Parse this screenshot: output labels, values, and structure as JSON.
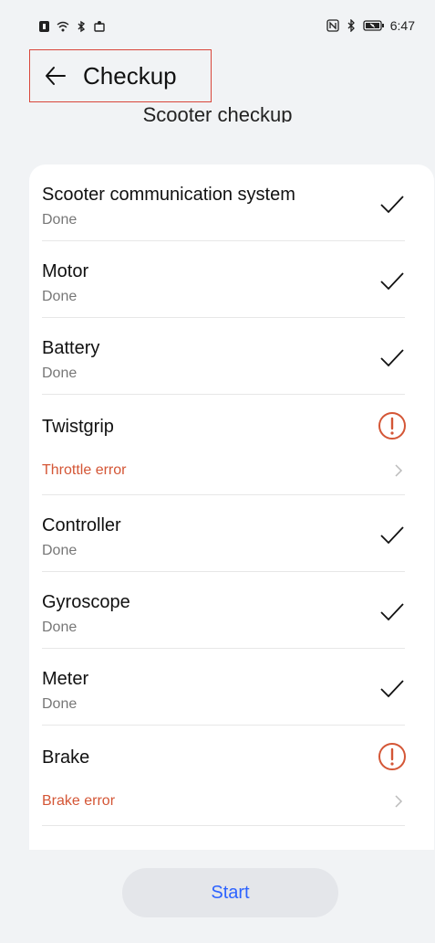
{
  "status_bar": {
    "time": "6:47",
    "icons_left": [
      "notification-icon",
      "wifi-icon",
      "bluetooth-share-icon",
      "cast-icon"
    ],
    "icons_right": [
      "nfc-icon",
      "bluetooth-icon",
      "battery-icon"
    ]
  },
  "header": {
    "title": "Checkup",
    "back_icon": "arrow-left-icon"
  },
  "section_title": "Scooter checkup",
  "items": [
    {
      "name": "Scooter communication system",
      "status": "Done",
      "state": "ok"
    },
    {
      "name": "Motor",
      "status": "Done",
      "state": "ok"
    },
    {
      "name": "Battery",
      "status": "Done",
      "state": "ok"
    },
    {
      "name": "Twistgrip",
      "status": "Throttle error",
      "state": "error"
    },
    {
      "name": "Controller",
      "status": "Done",
      "state": "ok"
    },
    {
      "name": "Gyroscope",
      "status": "Done",
      "state": "ok"
    },
    {
      "name": "Meter",
      "status": "Done",
      "state": "ok"
    },
    {
      "name": "Brake",
      "status": "Brake error",
      "state": "error"
    }
  ],
  "start_button": {
    "label": "Start"
  },
  "colors": {
    "background": "#f1f3f5",
    "card": "#ffffff",
    "error": "#d45636",
    "accent": "#2d63ff",
    "highlight_border": "#d9463a"
  }
}
